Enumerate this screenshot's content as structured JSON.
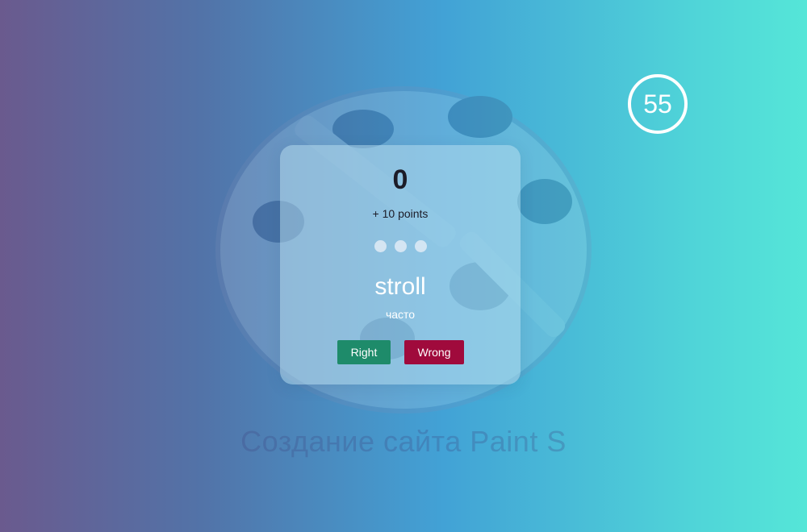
{
  "background": {
    "caption": "Создание сайта Paint S",
    "art": "palette-illustration"
  },
  "timer": {
    "value": "55"
  },
  "card": {
    "score": "0",
    "points_label": "+ 10 points",
    "dots_total": 3,
    "word": "stroll",
    "translation": "часто",
    "right_label": "Right",
    "wrong_label": "Wrong"
  },
  "colors": {
    "right_button": "#1e8b6a",
    "wrong_button": "#a00a3c",
    "timer_ring": "#ffffff"
  }
}
